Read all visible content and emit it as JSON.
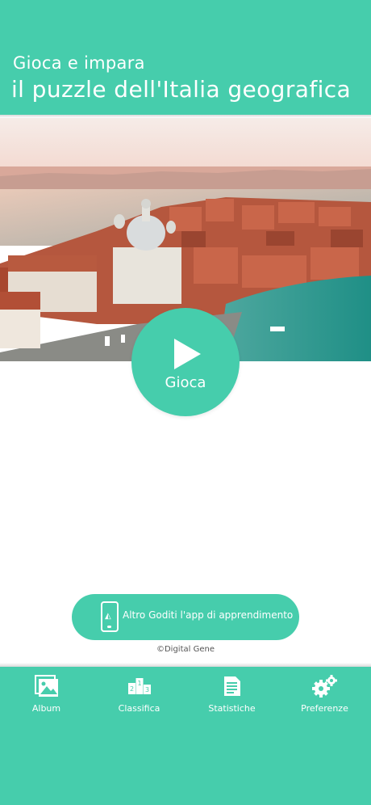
{
  "header": {
    "subtitle": "Gioca e impara",
    "title": "il puzzle dell'Italia geografica"
  },
  "hero": {
    "alt": "Venice aerial view"
  },
  "play_button": {
    "label": "Gioca",
    "icon": "play-icon"
  },
  "promo_button": {
    "label": "Altro Goditi l'app di apprendimento",
    "icon": "phone-app-icon"
  },
  "copyright": "©Digital Gene",
  "tabs": [
    {
      "label": "Album",
      "icon": "album-icon"
    },
    {
      "label": "Classifica",
      "icon": "podium-icon"
    },
    {
      "label": "Statistiche",
      "icon": "document-icon"
    },
    {
      "label": "Preferenze",
      "icon": "gears-icon"
    }
  ],
  "colors": {
    "accent": "#46cdac",
    "text_on_accent": "#ffffff"
  }
}
